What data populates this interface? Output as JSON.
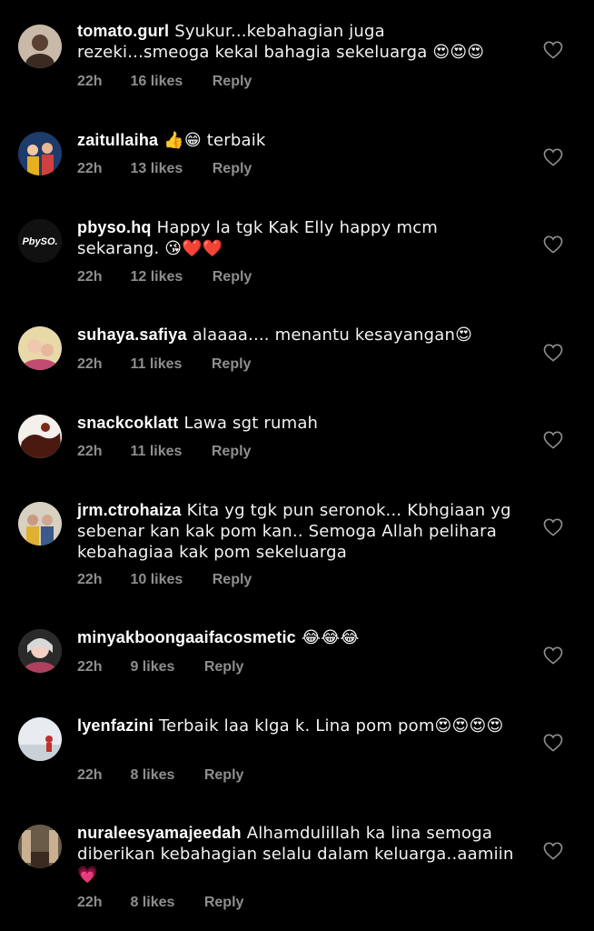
{
  "comments": [
    {
      "username": "tomato.gurl",
      "text": "Syukur...kebahagian juga rezeki...smeoga kekal bahagia sekeluarga 😍😍😍",
      "time": "22h",
      "likes": "16 likes",
      "reply": "Reply"
    },
    {
      "username": "zaitullaiha",
      "text": "👍😁 terbaik",
      "time": "22h",
      "likes": "13 likes",
      "reply": "Reply"
    },
    {
      "username": "pbyso.hq",
      "text": "Happy la tgk Kak Elly happy mcm sekarang. 😘❤️❤️",
      "time": "22h",
      "likes": "12 likes",
      "reply": "Reply",
      "avatar_text": "PbySO."
    },
    {
      "username": "suhaya.safiya",
      "text": "alaaaa.... menantu kesayangan😍",
      "time": "22h",
      "likes": "11 likes",
      "reply": "Reply"
    },
    {
      "username": "snackcoklatt",
      "text": "Lawa sgt rumah",
      "time": "22h",
      "likes": "11 likes",
      "reply": "Reply"
    },
    {
      "username": "jrm.ctrohaiza",
      "text": "Kita yg tgk pun seronok... Kbhgiaan yg sebenar kan kak pom kan.. Semoga Allah pelihara kebahagiaa kak pom sekeluarga",
      "time": "22h",
      "likes": "10 likes",
      "reply": "Reply"
    },
    {
      "username": "minyakboongaaifacosmetic",
      "text": "😂😂😂",
      "time": "22h",
      "likes": "9 likes",
      "reply": "Reply"
    },
    {
      "username": "lyenfazini",
      "text": "Terbaik laa klga k. Lina pom pom😍😍😍😍",
      "time": "22h",
      "likes": "8 likes",
      "reply": "Reply"
    },
    {
      "username": "nuraleesyamajeedah",
      "text": "Alhamdulillah ka lina semoga diberikan kebahagian selalu dalam keluarga..aamiin 💗",
      "time": "22h",
      "likes": "8 likes",
      "reply": "Reply"
    }
  ],
  "icons": {
    "like": "heart-outline-icon"
  },
  "colors": {
    "background": "#000000",
    "text": "#ffffff",
    "meta": "#8e8e8e"
  }
}
